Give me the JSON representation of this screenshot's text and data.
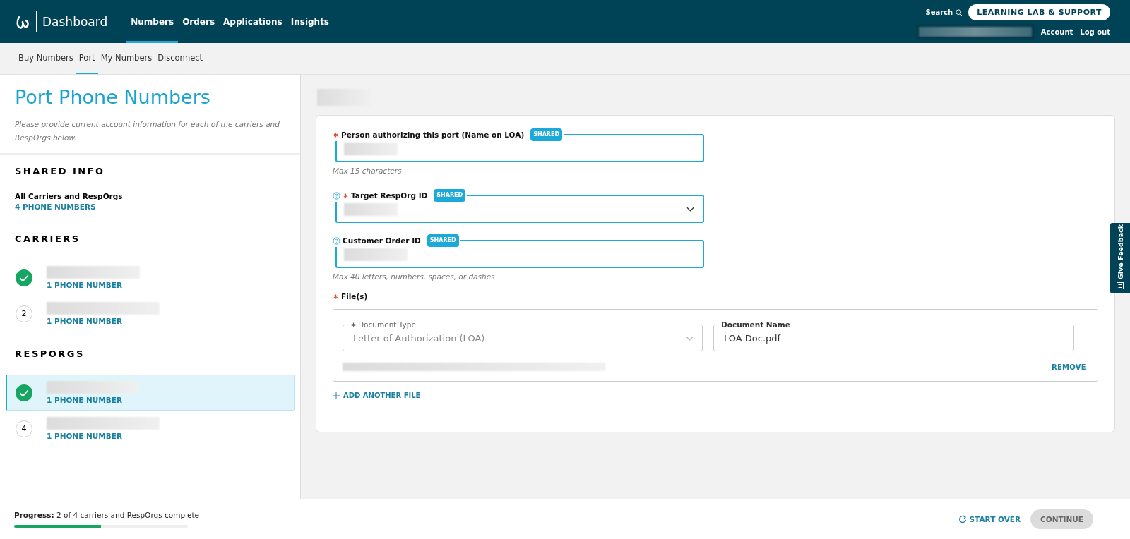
{
  "header": {
    "app_title": "Dashboard",
    "nav": [
      {
        "label": "Numbers",
        "selected": true
      },
      {
        "label": "Orders",
        "selected": false
      },
      {
        "label": "Applications",
        "selected": false
      },
      {
        "label": "Insights",
        "selected": false
      }
    ],
    "search": "Search",
    "support_button": "LEARNING LAB & SUPPORT",
    "account": "Account",
    "logout": "Log out"
  },
  "subnav": [
    {
      "label": "Buy Numbers",
      "selected": false
    },
    {
      "label": "Port",
      "selected": true
    },
    {
      "label": "My Numbers",
      "selected": false
    },
    {
      "label": "Disconnect",
      "selected": false
    }
  ],
  "sidebar": {
    "title": "Port Phone Numbers",
    "description": "Please provide current account information for each of the carriers and RespOrgs below.",
    "shared_info": {
      "heading": "SHARED INFO",
      "name": "All Carriers and RespOrgs",
      "count": "4 PHONE NUMBERS"
    },
    "groups": [
      {
        "heading": "CARRIERS",
        "items": [
          {
            "complete": true,
            "count": "1 PHONE NUMBER",
            "selected": false
          },
          {
            "complete": false,
            "step": "2",
            "count": "1 PHONE NUMBER",
            "selected": false
          }
        ]
      },
      {
        "heading": "RESPORGS",
        "items": [
          {
            "complete": true,
            "count": "1 PHONE NUMBER",
            "selected": true
          },
          {
            "complete": false,
            "step": "4",
            "count": "1 PHONE NUMBER",
            "selected": false
          }
        ]
      }
    ]
  },
  "form": {
    "fields": [
      {
        "kind": "text",
        "label": "Person authorizing this port (Name on LOA)",
        "required": true,
        "help": false,
        "badge": "SHARED",
        "hint": "Max 15 characters"
      },
      {
        "kind": "select",
        "label": "Target RespOrg ID",
        "required": true,
        "help": true,
        "badge": "SHARED"
      },
      {
        "kind": "text",
        "label": "Customer Order ID",
        "required": false,
        "help": true,
        "badge": "SHARED",
        "hint": "Max 40 letters, numbers, spaces, or dashes"
      }
    ],
    "files": {
      "label": "File(s)",
      "required": true,
      "document_type": {
        "label": "Document Type",
        "required": true,
        "value": "Letter of Authorization (LOA)",
        "disabled": true
      },
      "document_name": {
        "label": "Document Name",
        "value": "LOA Doc.pdf"
      },
      "remove": "REMOVE",
      "add": "ADD ANOTHER FILE"
    }
  },
  "feedback_tab": "Give Feedback",
  "footer": {
    "progress_text": "**Progress:** 2 of 4 carriers and RespOrgs complete",
    "level": 0.5,
    "start_over": "START OVER",
    "continue": {
      "label": "CONTINUE",
      "disabled": true
    }
  }
}
